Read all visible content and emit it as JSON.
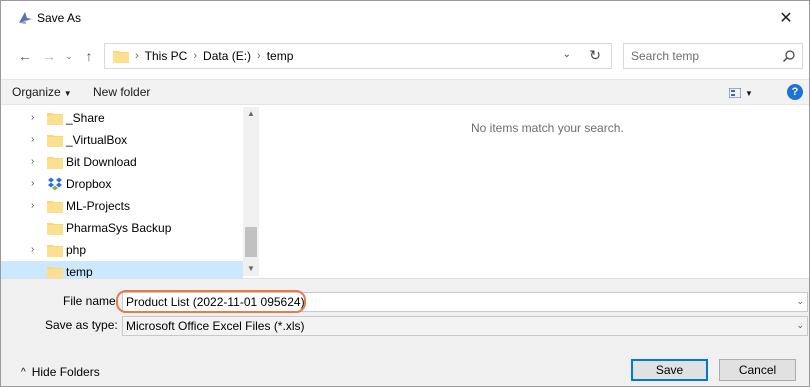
{
  "window": {
    "title": "Save As"
  },
  "address": {
    "breadcrumbs": [
      "This PC",
      "Data (E:)",
      "temp"
    ]
  },
  "search": {
    "placeholder": "Search temp"
  },
  "toolbar": {
    "organize_label": "Organize",
    "new_folder_label": "New folder"
  },
  "nav": {
    "items": [
      {
        "label": "_Share",
        "expandable": true,
        "selected": false
      },
      {
        "label": "_VirtualBox",
        "expandable": true,
        "selected": false
      },
      {
        "label": "Bit Download",
        "expandable": true,
        "selected": false
      },
      {
        "label": "Dropbox",
        "expandable": true,
        "selected": false,
        "icon": "dropbox-icon"
      },
      {
        "label": "ML-Projects",
        "expandable": true,
        "selected": false
      },
      {
        "label": "PharmaSys Backup",
        "expandable": false,
        "selected": false
      },
      {
        "label": "php",
        "expandable": true,
        "selected": false
      },
      {
        "label": "temp",
        "expandable": false,
        "selected": true
      }
    ]
  },
  "content": {
    "empty_message": "No items match your search."
  },
  "form": {
    "file_name_label": "File name:",
    "file_name_value": "Product List (2022-11-01 095624)",
    "save_type_label": "Save as type:",
    "save_type_value": "Microsoft Office Excel Files (*.xls)"
  },
  "footer": {
    "hide_folders_label": "Hide Folders",
    "save_label": "Save",
    "cancel_label": "Cancel"
  },
  "colors": {
    "accent": "#0078d7",
    "selection": "#cce8ff",
    "highlight_ring": "#e87b4a",
    "folder": "#f8d775",
    "help": "#1e73d6"
  }
}
